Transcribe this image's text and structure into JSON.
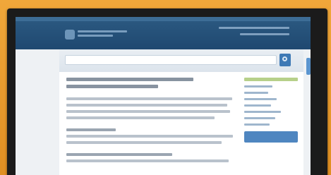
{
  "colors": {
    "background": "#e59a2c",
    "frame": "#1b1b1b",
    "header": "#1f4870",
    "accent": "#3e79b5",
    "sidebar_accent": "#b7d08a"
  },
  "icons": {
    "search": "search-icon",
    "logo": "site-logo"
  }
}
